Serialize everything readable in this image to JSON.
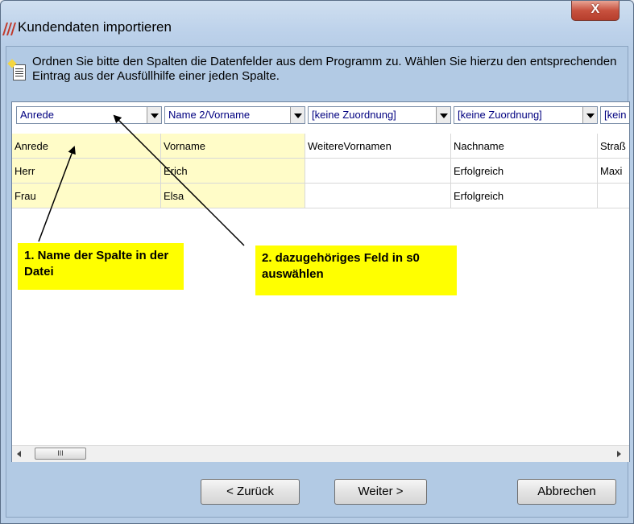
{
  "window": {
    "title": "Kundendaten importieren",
    "close_label": "X"
  },
  "info": {
    "text": "Ordnen Sie bitte den Spalten die Datenfelder aus dem Programm zu. Wählen Sie hierzu den entsprechenden Eintrag aus der Ausfüllhilfe einer jeden Spalte."
  },
  "grid": {
    "column_mappings": [
      "Anrede",
      "Name 2/Vorname",
      "[keine Zuordnung]",
      "[keine Zuordnung]",
      "[kein"
    ],
    "rows": [
      [
        "Anrede",
        "Vorname",
        "WeitereVornamen",
        "Nachname",
        "Straß"
      ],
      [
        "Herr",
        "Erich",
        "",
        "Erfolgreich",
        "Maxi"
      ],
      [
        "Frau",
        "Elsa",
        "",
        "Erfolgreich",
        ""
      ]
    ],
    "scrollbar_thumb_label": "III"
  },
  "callouts": {
    "first": "1. Name der Spalte in der  Datei",
    "second": "2. dazugehöriges Feld in s0 auswählen"
  },
  "buttons": {
    "back": "< Zurück",
    "next": "Weiter >",
    "cancel": "Abbrechen"
  },
  "colors": {
    "highlight": "#fffcc8",
    "callout": "#ffff00",
    "header_text": "#000080"
  }
}
